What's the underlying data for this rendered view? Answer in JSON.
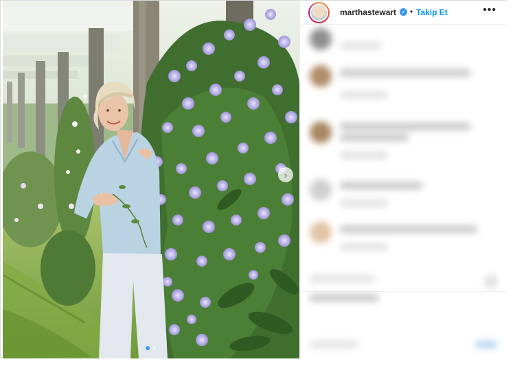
{
  "post": {
    "carousel": {
      "slide_count": 2,
      "active_slide": 1
    }
  },
  "header": {
    "username": "marthastewart",
    "verified": true,
    "separator": "•",
    "follow_label": "Takip Et",
    "more_label": "•••"
  },
  "colors": {
    "link_blue": "#0095f6",
    "verified_blue": "#3897f0",
    "text": "#262626",
    "border": "#dbdbdb"
  },
  "icons": {
    "verified": "verified-badge-icon",
    "more": "more-options-icon",
    "next": "chevron-right-icon"
  }
}
